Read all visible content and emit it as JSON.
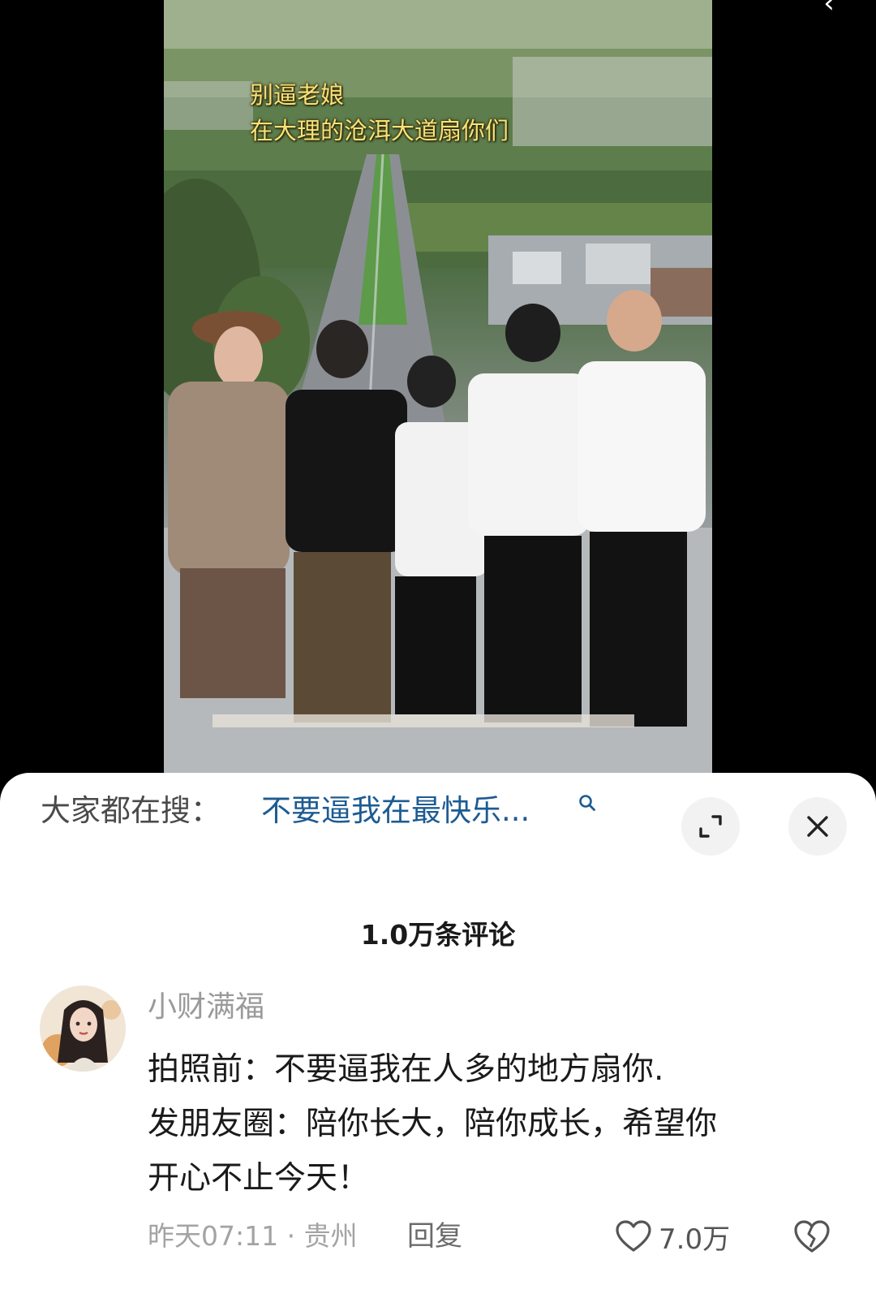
{
  "video": {
    "caption_line1": "别逼老娘",
    "caption_line2": "在大理的沧洱大道扇你们"
  },
  "search": {
    "prefix": "大家都在搜：",
    "query": "不要逼我在最快乐..."
  },
  "comments": {
    "title": "1.0万条评论",
    "items": [
      {
        "username": "小财满福",
        "lines": [
          "拍照前：不要逼我在人多的地方扇你.",
          "发朋友圈：陪你长大，陪你成长，希望你",
          "开心不止今天！"
        ],
        "meta": "昨天07:11 · 贵州",
        "reply_label": "回复",
        "likes": "7.0万"
      }
    ]
  },
  "colors": {
    "caption": "#f6e27a",
    "query_link": "#1d5b92",
    "sheet_bg": "#ffffff"
  },
  "icons": [
    "search-icon",
    "expand-icon",
    "close-icon",
    "heart-icon",
    "broken-heart-icon",
    "back-icon"
  ]
}
